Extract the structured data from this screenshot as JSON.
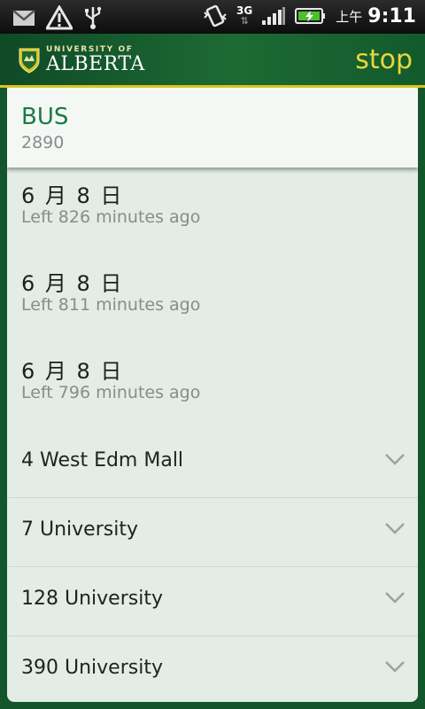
{
  "status_bar": {
    "network": "3G",
    "ampm": "上午",
    "time": "9:11",
    "icons": [
      "gmail-icon",
      "warning-icon",
      "usb-icon",
      "vibrate-icon",
      "signal-icon",
      "battery-charging-icon"
    ]
  },
  "header": {
    "logo_small": "UNIVERSITY OF",
    "logo_big": "ALBERTA",
    "title": "stop"
  },
  "info": {
    "title": "BUS",
    "subtitle": "2890"
  },
  "departures": [
    {
      "date": "6 月 8 日",
      "left": "Left 826 minutes ago"
    },
    {
      "date": "6 月 8 日",
      "left": "Left 811 minutes ago"
    },
    {
      "date": "6 月 8 日",
      "left": "Left 796 minutes ago"
    }
  ],
  "routes": [
    {
      "label": "4 West Edm Mall"
    },
    {
      "label": "7 University"
    },
    {
      "label": "128 University"
    },
    {
      "label": "390 University"
    }
  ],
  "colors": {
    "accent_green": "#1a7a43",
    "header_green": "#14562c",
    "gold": "#ead63a"
  }
}
